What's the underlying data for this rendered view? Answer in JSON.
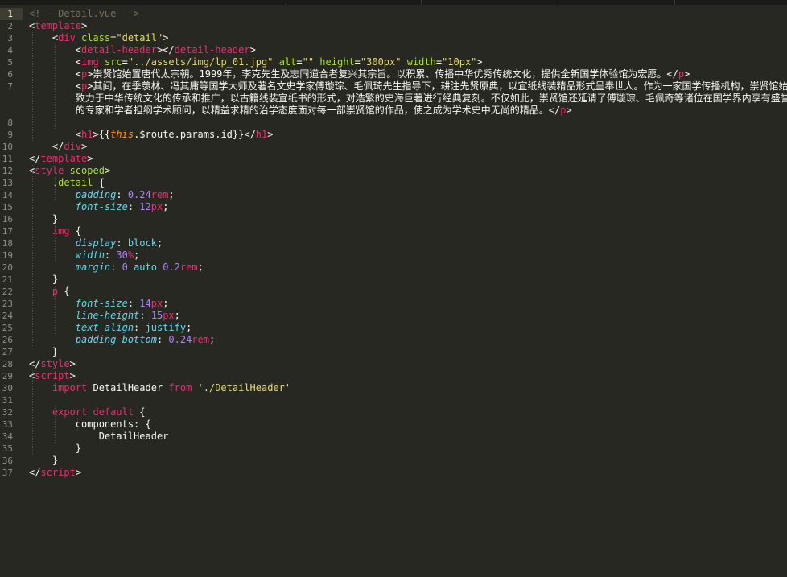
{
  "editor": {
    "file_comment": "<!-- Detail.vue -->",
    "lines": [
      {
        "n": "1",
        "segs": [
          {
            "c": "t-c",
            "t": "<!-- Detail.vue -->"
          }
        ]
      },
      {
        "n": "2",
        "segs": [
          {
            "c": "t-w",
            "t": "<"
          },
          {
            "c": "t-tag",
            "t": "template"
          },
          {
            "c": "t-w",
            "t": ">"
          }
        ]
      },
      {
        "n": "3",
        "segs": [
          {
            "c": "t-w",
            "t": "    <"
          },
          {
            "c": "t-tag",
            "t": "div"
          },
          {
            "c": "t-at",
            "t": " class"
          },
          {
            "c": "t-w",
            "t": "="
          },
          {
            "c": "t-str",
            "t": "\"detail\""
          },
          {
            "c": "t-w",
            "t": ">"
          }
        ]
      },
      {
        "n": "4",
        "segs": [
          {
            "c": "t-w",
            "t": "        <"
          },
          {
            "c": "t-tag",
            "t": "detail-header"
          },
          {
            "c": "t-w",
            "t": "></"
          },
          {
            "c": "t-tag",
            "t": "detail-header"
          },
          {
            "c": "t-w",
            "t": ">"
          }
        ]
      },
      {
        "n": "5",
        "segs": [
          {
            "c": "t-w",
            "t": "        <"
          },
          {
            "c": "t-tag",
            "t": "img"
          },
          {
            "c": "t-at",
            "t": " src"
          },
          {
            "c": "t-w",
            "t": "="
          },
          {
            "c": "t-str",
            "t": "\"../assets/img/lp_01.jpg\""
          },
          {
            "c": "t-at",
            "t": " alt"
          },
          {
            "c": "t-w",
            "t": "="
          },
          {
            "c": "t-str",
            "t": "\"\""
          },
          {
            "c": "t-at",
            "t": " height"
          },
          {
            "c": "t-w",
            "t": "="
          },
          {
            "c": "t-str",
            "t": "\"300px\""
          },
          {
            "c": "t-at",
            "t": " width"
          },
          {
            "c": "t-w",
            "t": "="
          },
          {
            "c": "t-str",
            "t": "\"10px\""
          },
          {
            "c": "t-w",
            "t": ">"
          }
        ]
      },
      {
        "n": "6",
        "segs": [
          {
            "c": "t-w",
            "t": "        <"
          },
          {
            "c": "t-tag",
            "t": "p"
          },
          {
            "c": "t-w",
            "t": ">崇贤馆始置唐代太宗朝。1999年，李克先生及志同道合者复兴其宗旨。以积累、传播中华优秀传统文化，提供全新国学体验馆为宏愿。</"
          },
          {
            "c": "t-tag",
            "t": "p"
          },
          {
            "c": "t-w",
            "t": ">"
          }
        ]
      },
      {
        "n": "7",
        "segs": [
          {
            "c": "t-w",
            "t": "        <"
          },
          {
            "c": "t-tag",
            "t": "p"
          },
          {
            "c": "t-w",
            "t": ">其间，在季羡林、冯其庸等国学大师及著名文史学家傅璇琮、毛佩琦先生指导下，耕注先贤原典，以宣纸线装精品形式呈奉世人。作为一家国学传播机构，崇贤馆始"
          }
        ]
      },
      {
        "n": "",
        "segs": [
          {
            "c": "t-w",
            "t": "        致力于中华传统文化的传承和推广，以古籍线装宣纸书的形式，对浩繁的史海巨著进行经典复刻。不仅如此，崇贤馆还延请了傅璇琮、毛佩奇等诸位在国学界内享有盛誉"
          }
        ]
      },
      {
        "n": "",
        "segs": [
          {
            "c": "t-w",
            "t": "        的专家和学者担纲学术顾问，以精益求精的治学态度面对每一部崇贤馆的作品，使之成为学术史中无尚的精品。</"
          },
          {
            "c": "t-tag",
            "t": "p"
          },
          {
            "c": "t-w",
            "t": ">"
          }
        ]
      },
      {
        "n": "8",
        "segs": []
      },
      {
        "n": "9",
        "segs": [
          {
            "c": "t-w",
            "t": "        <"
          },
          {
            "c": "t-tag",
            "t": "h1"
          },
          {
            "c": "t-w",
            "t": ">{{"
          },
          {
            "c": "t-th",
            "t": "this"
          },
          {
            "c": "t-w",
            "t": ".$route.params.id}}</"
          },
          {
            "c": "t-tag",
            "t": "h1"
          },
          {
            "c": "t-w",
            "t": ">"
          }
        ]
      },
      {
        "n": "10",
        "segs": [
          {
            "c": "t-w",
            "t": "    </"
          },
          {
            "c": "t-tag",
            "t": "div"
          },
          {
            "c": "t-w",
            "t": ">"
          }
        ]
      },
      {
        "n": "11",
        "segs": [
          {
            "c": "t-w",
            "t": "</"
          },
          {
            "c": "t-tag",
            "t": "template"
          },
          {
            "c": "t-w",
            "t": ">"
          }
        ]
      },
      {
        "n": "12",
        "segs": [
          {
            "c": "t-w",
            "t": "<"
          },
          {
            "c": "t-tag",
            "t": "style"
          },
          {
            "c": "t-at",
            "t": " scoped"
          },
          {
            "c": "t-w",
            "t": ">"
          }
        ]
      },
      {
        "n": "13",
        "segs": [
          {
            "c": "t-sel",
            "t": "    .detail"
          },
          {
            "c": "t-w",
            "t": " {"
          }
        ]
      },
      {
        "n": "14",
        "segs": [
          {
            "c": "t-pr",
            "t": "        padding"
          },
          {
            "c": "t-w",
            "t": ": "
          },
          {
            "c": "t-num",
            "t": "0.24"
          },
          {
            "c": "t-un",
            "t": "rem"
          },
          {
            "c": "t-w",
            "t": ";"
          }
        ]
      },
      {
        "n": "15",
        "segs": [
          {
            "c": "t-pr",
            "t": "        font-size"
          },
          {
            "c": "t-w",
            "t": ": "
          },
          {
            "c": "t-num",
            "t": "12"
          },
          {
            "c": "t-un",
            "t": "px"
          },
          {
            "c": "t-w",
            "t": ";"
          }
        ]
      },
      {
        "n": "16",
        "segs": [
          {
            "c": "t-w",
            "t": "    }"
          }
        ]
      },
      {
        "n": "17",
        "segs": [
          {
            "c": "t-tag",
            "t": "    img"
          },
          {
            "c": "t-w",
            "t": " {"
          }
        ]
      },
      {
        "n": "18",
        "segs": [
          {
            "c": "t-pr",
            "t": "        display"
          },
          {
            "c": "t-w",
            "t": ": "
          },
          {
            "c": "t-val",
            "t": "block"
          },
          {
            "c": "t-w",
            "t": ";"
          }
        ]
      },
      {
        "n": "19",
        "segs": [
          {
            "c": "t-pr",
            "t": "        width"
          },
          {
            "c": "t-w",
            "t": ": "
          },
          {
            "c": "t-num",
            "t": "30"
          },
          {
            "c": "t-un",
            "t": "%"
          },
          {
            "c": "t-w",
            "t": ";"
          }
        ]
      },
      {
        "n": "20",
        "segs": [
          {
            "c": "t-pr",
            "t": "        margin"
          },
          {
            "c": "t-w",
            "t": ": "
          },
          {
            "c": "t-num",
            "t": "0"
          },
          {
            "c": "t-val",
            "t": " auto"
          },
          {
            "c": "t-num",
            "t": " 0.2"
          },
          {
            "c": "t-un",
            "t": "rem"
          },
          {
            "c": "t-w",
            "t": ";"
          }
        ]
      },
      {
        "n": "21",
        "segs": [
          {
            "c": "t-w",
            "t": "    }"
          }
        ]
      },
      {
        "n": "22",
        "segs": [
          {
            "c": "t-tag",
            "t": "    p"
          },
          {
            "c": "t-w",
            "t": " {"
          }
        ]
      },
      {
        "n": "23",
        "segs": [
          {
            "c": "t-pr",
            "t": "        font-size"
          },
          {
            "c": "t-w",
            "t": ": "
          },
          {
            "c": "t-num",
            "t": "14"
          },
          {
            "c": "t-un",
            "t": "px"
          },
          {
            "c": "t-w",
            "t": ";"
          }
        ]
      },
      {
        "n": "24",
        "segs": [
          {
            "c": "t-pr",
            "t": "        line-height"
          },
          {
            "c": "t-w",
            "t": ": "
          },
          {
            "c": "t-num",
            "t": "15"
          },
          {
            "c": "t-un",
            "t": "px"
          },
          {
            "c": "t-w",
            "t": ";"
          }
        ]
      },
      {
        "n": "25",
        "segs": [
          {
            "c": "t-pr",
            "t": "        text-align"
          },
          {
            "c": "t-w",
            "t": ": "
          },
          {
            "c": "t-val",
            "t": "justify"
          },
          {
            "c": "t-w",
            "t": ";"
          }
        ]
      },
      {
        "n": "26",
        "segs": [
          {
            "c": "t-pr",
            "t": "        padding-bottom"
          },
          {
            "c": "t-w",
            "t": ": "
          },
          {
            "c": "t-num",
            "t": "0.24"
          },
          {
            "c": "t-un",
            "t": "rem"
          },
          {
            "c": "t-w",
            "t": ";"
          }
        ]
      },
      {
        "n": "27",
        "segs": [
          {
            "c": "t-w",
            "t": "    }"
          }
        ]
      },
      {
        "n": "28",
        "segs": [
          {
            "c": "t-w",
            "t": "</"
          },
          {
            "c": "t-tag",
            "t": "style"
          },
          {
            "c": "t-w",
            "t": ">"
          }
        ]
      },
      {
        "n": "29",
        "segs": [
          {
            "c": "t-w",
            "t": "<"
          },
          {
            "c": "t-tag",
            "t": "script"
          },
          {
            "c": "t-w",
            "t": ">"
          }
        ]
      },
      {
        "n": "30",
        "segs": [
          {
            "c": "t-kw",
            "t": "    import"
          },
          {
            "c": "t-w",
            "t": " DetailHeader "
          },
          {
            "c": "t-kw",
            "t": "from"
          },
          {
            "c": "t-str",
            "t": " './DetailHeader'"
          }
        ]
      },
      {
        "n": "31",
        "segs": []
      },
      {
        "n": "32",
        "segs": [
          {
            "c": "t-kw",
            "t": "    export default"
          },
          {
            "c": "t-w",
            "t": " {"
          }
        ]
      },
      {
        "n": "33",
        "segs": [
          {
            "c": "t-w",
            "t": "        components: {"
          }
        ]
      },
      {
        "n": "34",
        "segs": [
          {
            "c": "t-w",
            "t": "            DetailHeader"
          }
        ]
      },
      {
        "n": "35",
        "segs": [
          {
            "c": "t-w",
            "t": "        }"
          }
        ]
      },
      {
        "n": "36",
        "segs": [
          {
            "c": "t-w",
            "t": "    }"
          }
        ]
      },
      {
        "n": "37",
        "segs": [
          {
            "c": "t-w",
            "t": "</"
          },
          {
            "c": "t-tag",
            "t": "script"
          },
          {
            "c": "t-w",
            "t": ">"
          }
        ]
      }
    ],
    "active_line": "1"
  },
  "colors": {
    "background": "#272822",
    "comment": "#75715e",
    "tag": "#f92672",
    "attribute": "#a6e22e",
    "string": "#e6db74",
    "number": "#ae81ff",
    "property": "#66d9ef"
  }
}
